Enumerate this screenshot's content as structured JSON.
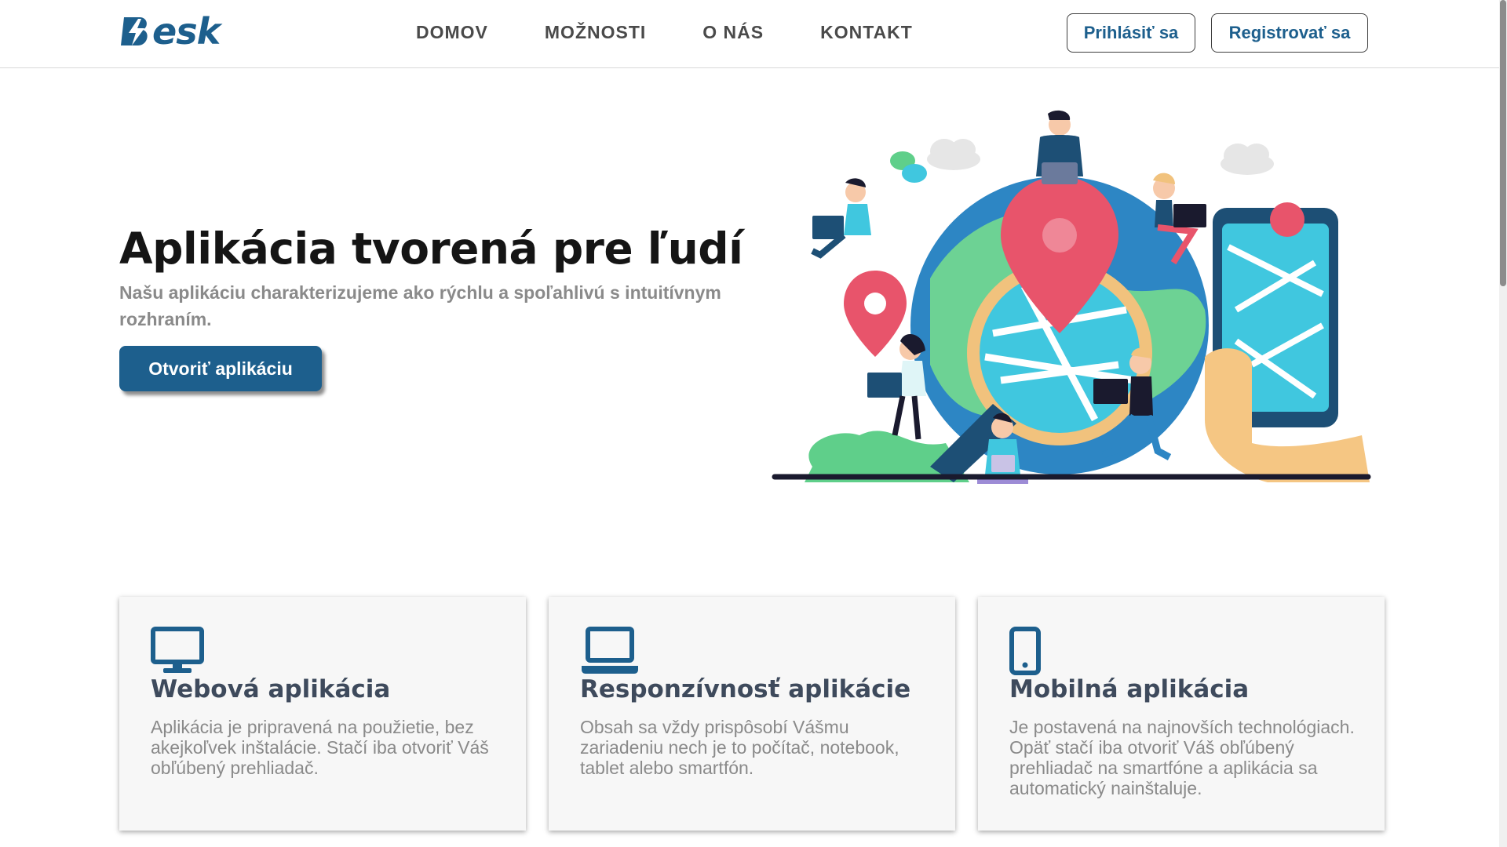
{
  "header": {
    "logo_text": "esk",
    "logo_color": "#1d5f8d",
    "nav": [
      "DOMOV",
      "MOŽNOSTI",
      "O NÁS",
      "KONTAKT"
    ],
    "login_label": "Prihlásiť sa",
    "register_label": "Registrovať sa"
  },
  "hero": {
    "title": "Aplikácia tvorená pre ľudí",
    "subtitle": "Našu aplikáciu charakterizujeme ako rýchlu a spoľahlivú s intuitívnym rozhraním.",
    "cta_label": "Otvoriť aplikáciu"
  },
  "features": [
    {
      "icon": "monitor-icon",
      "title": "Webová aplikácia",
      "text": "Aplikácia je pripravená na použietie, bez akejkoľvek inštalácie. Stačí iba otvoriť Váš obľúbený prehliadač."
    },
    {
      "icon": "laptop-icon",
      "title": "Responzívnosť aplikácie",
      "text": "Obsah sa vždy prispôsobí Vášmu zariadeniu nech je to počítač, notebook, tablet alebo smartfón."
    },
    {
      "icon": "smartphone-icon",
      "title": "Mobilná aplikácia",
      "text": "Je postavená na najnovších technológiach. Opäť stačí iba otvoriť Váš obľúbený prehliadač na smartfóne a aplikácia sa automatický nainštaluje."
    }
  ],
  "colors": {
    "brand": "#1d5f8d",
    "text_muted": "#8a8a8a",
    "card_background": "#f7f7f7"
  }
}
